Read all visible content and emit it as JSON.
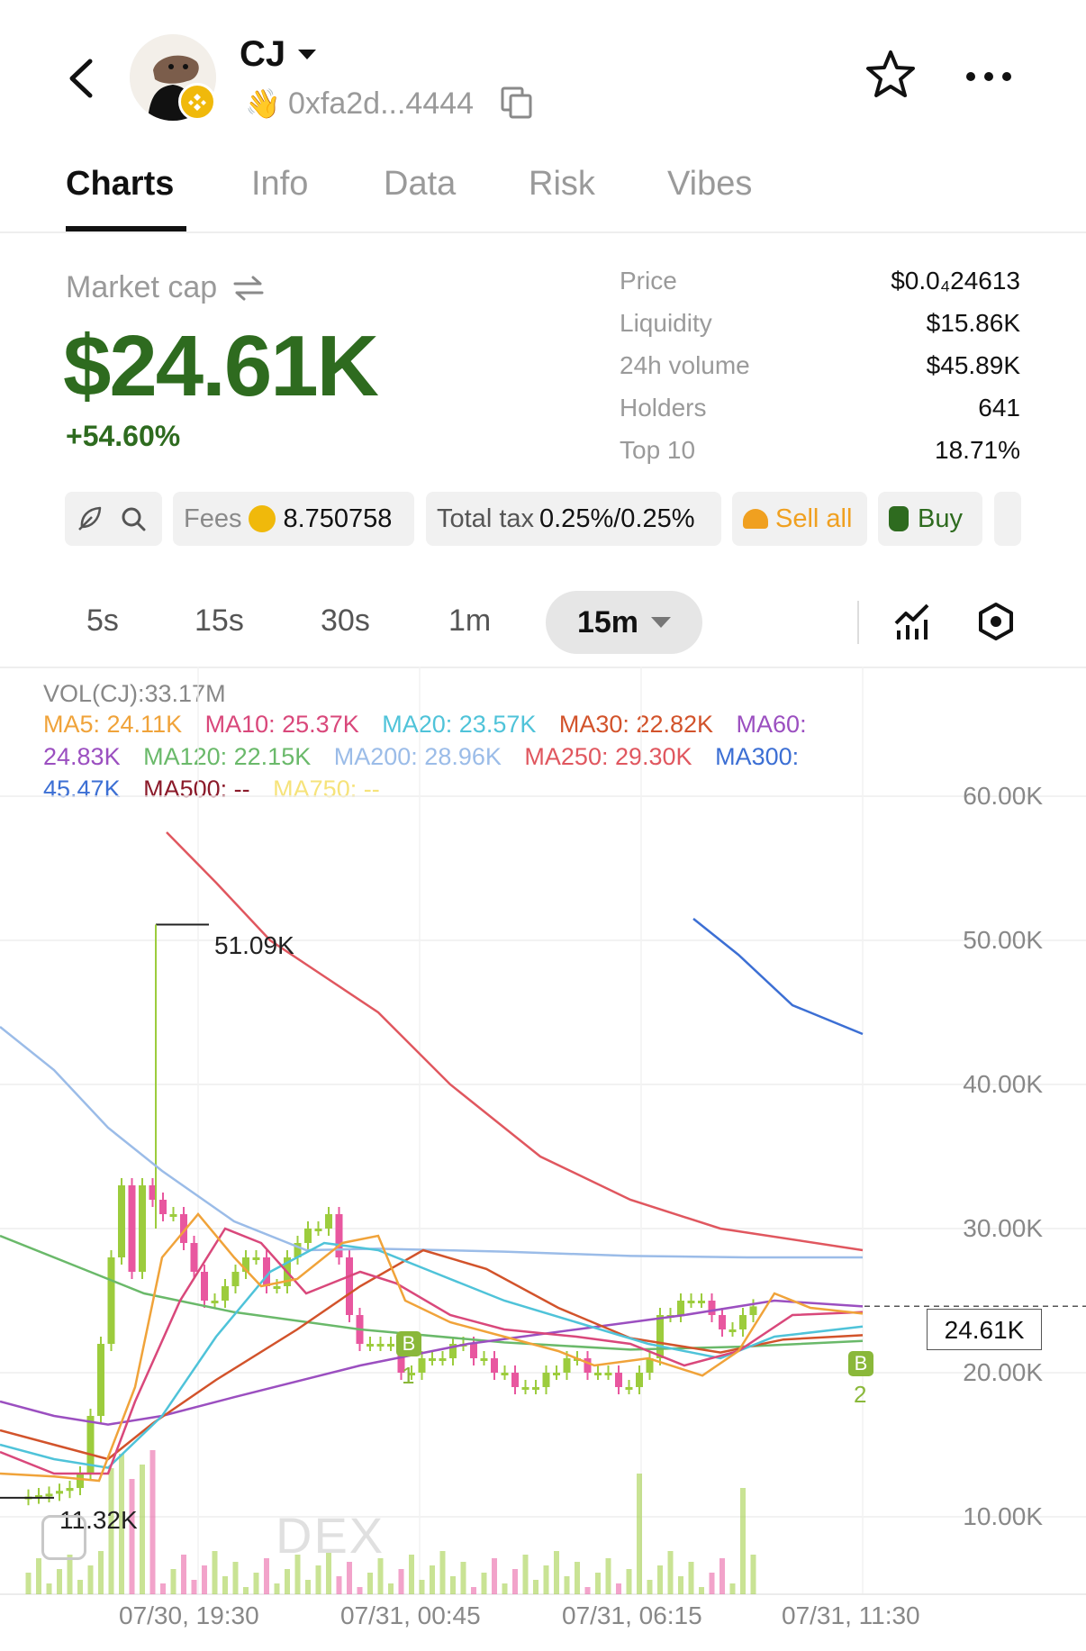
{
  "header": {
    "token_name": "CJ",
    "address": "0xfa2d...4444"
  },
  "tabs": [
    "Charts",
    "Info",
    "Data",
    "Risk",
    "Vibes"
  ],
  "market": {
    "label": "Market cap",
    "value": "$24.61K",
    "change": "+54.60%"
  },
  "stats": [
    {
      "label": "Price",
      "value": "$0.0₄24613"
    },
    {
      "label": "Liquidity",
      "value": "$15.86K"
    },
    {
      "label": "24h volume",
      "value": "$45.89K"
    },
    {
      "label": "Holders",
      "value": "641"
    },
    {
      "label": "Top 10",
      "value": "18.71%"
    }
  ],
  "chips": {
    "fees_label": "Fees",
    "fees_value": "8.750758",
    "tax_label": "Total tax",
    "tax_value": "0.25%/0.25%",
    "sell_all": "Sell all",
    "buy": "Buy"
  },
  "timeframes": [
    "5s",
    "15s",
    "30s",
    "1m",
    "15m"
  ],
  "selected_timeframe": "15m",
  "indicators": {
    "vol": "VOL(CJ):33.17M",
    "ma5": "MA5: 24.11K",
    "ma10": "MA10: 25.37K",
    "ma20": "MA20: 23.57K",
    "ma30": "MA30: 22.82K",
    "ma60_a": "MA60:",
    "ma60_b": "24.83K",
    "ma120": "MA120: 22.15K",
    "ma200": "MA200: 28.96K",
    "ma250": "MA250: 29.30K",
    "ma300_a": "MA300:",
    "ma300_b": "45.47K",
    "ma500": "MA500: --",
    "ma750": "MA750: --"
  },
  "colors": {
    "green": "#2e6b1f",
    "up": "#9ccc3d",
    "down": "#e8579f",
    "ma5": "#f0a33a",
    "ma10": "#d9487b",
    "ma20": "#4fc3d9",
    "ma30": "#d2532b",
    "ma60": "#9b4fc0",
    "ma120": "#6ab96a",
    "ma200": "#9bbce8",
    "ma250": "#e0575f",
    "ma300": "#3c6fd4",
    "ma500": "#8b1a2a",
    "ma750": "#f6e37a"
  },
  "chart_data": {
    "type": "candlestick",
    "y_axis_ticks": [
      "60.00K",
      "50.00K",
      "40.00K",
      "30.00K",
      "20.00K",
      "10.00K"
    ],
    "x_axis_ticks": [
      "07/30, 19:30",
      "07/31, 00:45",
      "07/31, 06:15",
      "07/31, 11:30"
    ],
    "ylim": [
      10000,
      60000
    ],
    "high_label": "51.09K",
    "low_label": "11.32K",
    "current_price_label": "24.61K",
    "markers": [
      {
        "label": "B",
        "index": "1"
      },
      {
        "label": "B",
        "index": "2"
      }
    ],
    "watermark": "DEX"
  }
}
